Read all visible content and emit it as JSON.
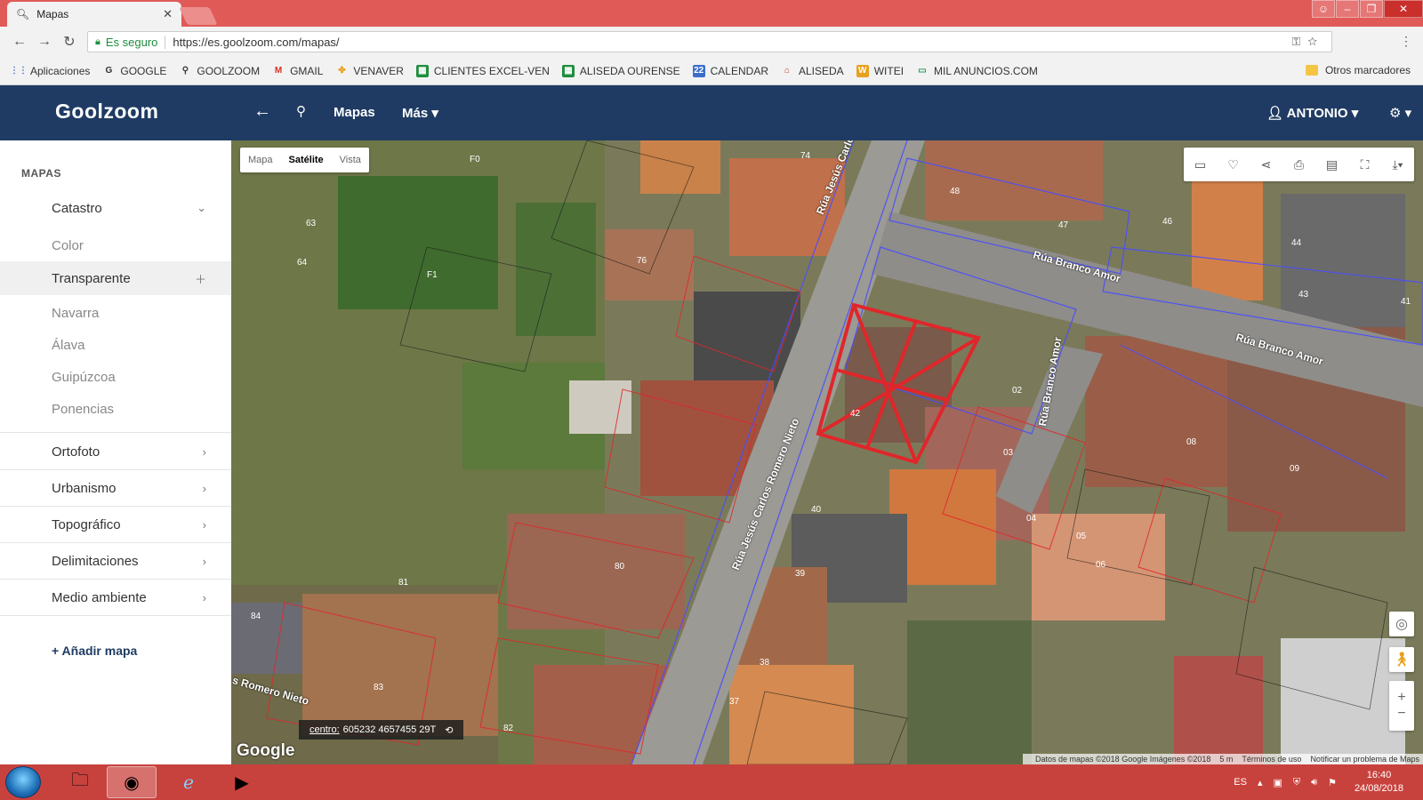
{
  "browser": {
    "tab_title": "Mapas",
    "tab_close": "✕",
    "secure_label": "Es seguro",
    "url": "https://es.goolzoom.com/mapas/",
    "bookmarks": [
      "Aplicaciones",
      "GOOGLE",
      "GOOLZOOM",
      "GMAIL",
      "VENAVER",
      "CLIENTES EXCEL-VEN",
      "ALISEDA OURENSE",
      "CALENDAR",
      "ALISEDA",
      "WITEI",
      "MIL ANUNCIOS.COM"
    ],
    "other_bookmarks": "Otros marcadores"
  },
  "header": {
    "logo": "Goolzoom",
    "nav_mapas": "Mapas",
    "nav_mas": "Más ▾",
    "user": "ANTONIO ▾"
  },
  "sidebar": {
    "title": "MAPAS",
    "catastro": "Catastro",
    "catastro_sub": [
      "Color",
      "Transparente",
      "Navarra",
      "Álava",
      "Guipúzcoa",
      "Ponencias"
    ],
    "sections": [
      "Ortofoto",
      "Urbanismo",
      "Topográfico",
      "Delimitaciones",
      "Medio ambiente"
    ],
    "add_map": "+ Añadir mapa"
  },
  "map": {
    "types": [
      "Mapa",
      "Satélite",
      "Vista"
    ],
    "active_type": "Satélite",
    "street_labels": [
      "Rúa Jesús Carlos Romero Nieto",
      "Rúa Branco Amor",
      "Rúa Branco Amor",
      "Rúa Branco Amor",
      "Rúa Jesús Carlos Romero Nieto",
      "s Romero Nieto"
    ],
    "parcel_labels": [
      "74",
      "48",
      "47",
      "46",
      "76",
      "44",
      "43",
      "41",
      "42",
      "02",
      "03",
      "08",
      "09",
      "40",
      "04",
      "05",
      "06",
      "39",
      "80",
      "81",
      "84",
      "83",
      "38",
      "37",
      "82",
      "F1",
      "64",
      "63",
      "F0"
    ],
    "google": "Google",
    "centro_label": "centro:",
    "centro_value": "605232 4657455 29T",
    "attribution": [
      "Datos de mapas ©2018 Google Imágenes ©2018",
      "5 m",
      "Términos de uso",
      "Notificar un problema de Maps"
    ]
  },
  "taskbar": {
    "lang": "ES",
    "time": "16:40",
    "date": "24/08/2018"
  },
  "colors": {
    "header_bg": "#1f3b63",
    "parcel_red": "#e0262a",
    "parcel_blue": "#4a4dff",
    "taskbar": "#c8423d"
  }
}
